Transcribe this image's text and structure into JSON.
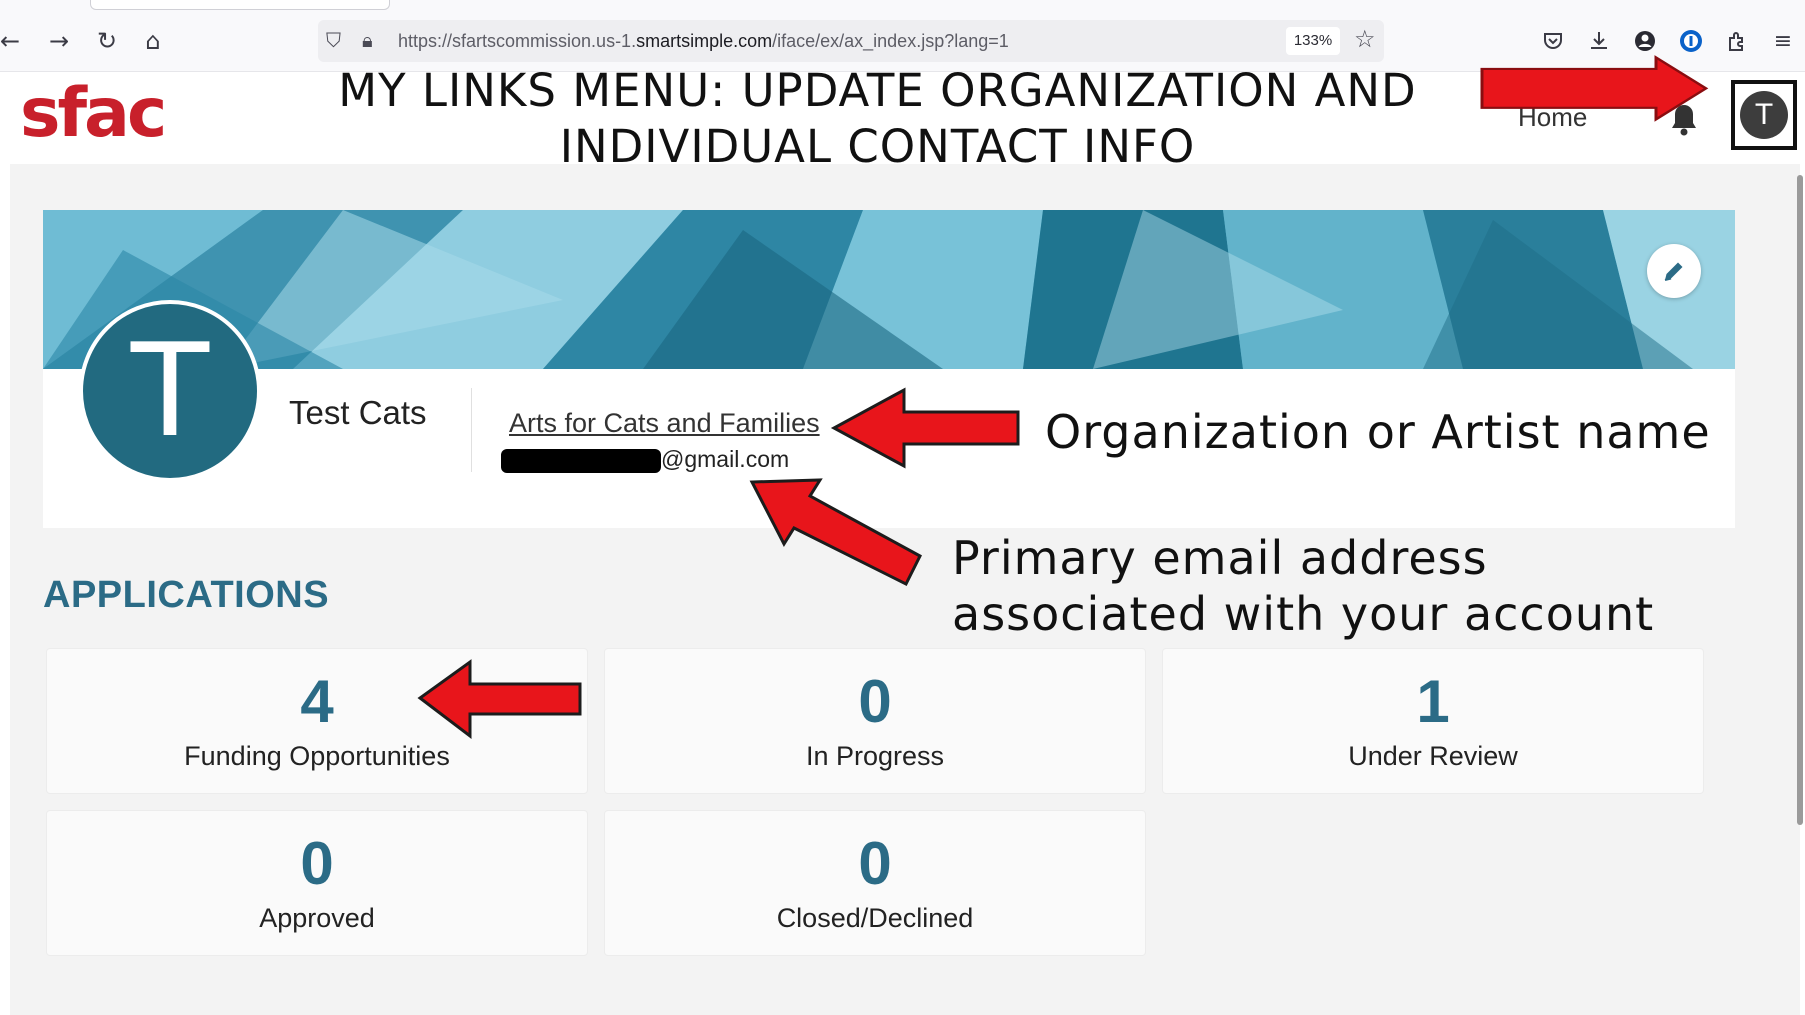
{
  "browser": {
    "url_prefix": "https://sfartscommission.us-1.",
    "url_domain": "smartsimple.com",
    "url_path": "/iface/ex/ax_index.jsp?lang=1",
    "zoom": "133%"
  },
  "header": {
    "logo": "sfac",
    "title_line1": "MY LINKS MENU: UPDATE ORGANIZATION AND",
    "title_line2": "INDIVIDUAL CONTACT INFO",
    "home_label": "Home",
    "avatar_initial": "T"
  },
  "profile": {
    "initial": "T",
    "name": "Test Cats",
    "organization": "Arts for Cats and Families",
    "email_domain": "@gmail.com"
  },
  "applications": {
    "title": "APPLICATIONS",
    "stats": [
      {
        "value": "4",
        "label": "Funding Opportunities"
      },
      {
        "value": "0",
        "label": "In Progress"
      },
      {
        "value": "1",
        "label": "Under Review"
      },
      {
        "value": "0",
        "label": "Approved"
      },
      {
        "value": "0",
        "label": "Closed/Declined"
      }
    ]
  },
  "annotations": {
    "org_note": "Organization or Artist name",
    "email_note_line1": "Primary email address",
    "email_note_line2": "associated with your account",
    "arrow_color": "#e8151b"
  },
  "colors": {
    "brand_red": "#c8202b",
    "accent_teal": "#2b6b86",
    "avatar_teal": "#226a80"
  },
  "icons": [
    "back-icon",
    "forward-icon",
    "reload-icon",
    "home-icon",
    "shield-icon",
    "lock-icon",
    "star-icon",
    "pocket-icon",
    "download-icon",
    "account-icon",
    "password-manager-icon",
    "extensions-icon",
    "menu-icon",
    "bell-icon",
    "pencil-icon"
  ]
}
